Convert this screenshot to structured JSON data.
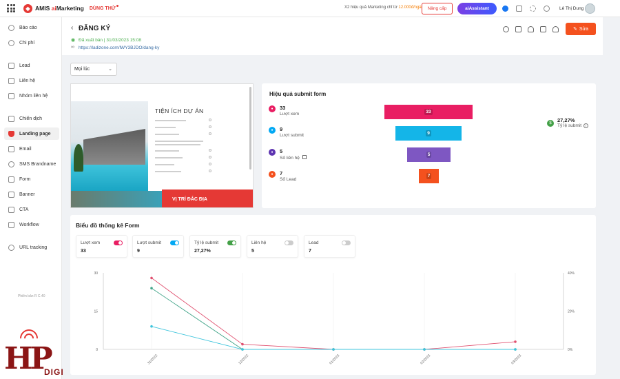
{
  "topbar": {
    "logo_text": "AMIS",
    "logo_ai": "ai",
    "logo_suffix": "Marketing",
    "trial": "DÙNG THỬ",
    "promo_text": "X2 hiệu quả Marketing chỉ từ",
    "promo_price": "12.000đ/ngày",
    "upgrade": "Nâng cấp",
    "ai_assistant": "aiAssistant",
    "user_name": "Lê Thị Dung"
  },
  "sidebar": {
    "items": [
      {
        "label": "Báo cáo"
      },
      {
        "label": "Chi phí"
      },
      {
        "label": "Lead"
      },
      {
        "label": "Liên hệ"
      },
      {
        "label": "Nhóm liên hệ"
      },
      {
        "label": "Chiến dịch"
      },
      {
        "label": "Landing page",
        "active": true
      },
      {
        "label": "Email"
      },
      {
        "label": "SMS Brandname"
      },
      {
        "label": "Form"
      },
      {
        "label": "Banner"
      },
      {
        "label": "CTA"
      },
      {
        "label": "Workflow"
      },
      {
        "label": "URL tracking"
      }
    ],
    "version": "Phiên bản R C.40"
  },
  "header": {
    "title": "ĐĂNG KÝ",
    "status": "Đã xuất bản | 31/03/2023 15:08",
    "url": "https://ladizone.com/lWY3BJDO/dang-ky",
    "edit": "Sửa"
  },
  "filter": {
    "value": "Mọi lúc"
  },
  "preview": {
    "heading": "TIỆN ÍCH DỰ ÁN",
    "banner": "VỊ TRÍ ĐẮC ĐỊA"
  },
  "funnel": {
    "title": "Hiệu quả submit form",
    "metrics": [
      {
        "value": "33",
        "label": "Lượt xem",
        "color": "#e91e63"
      },
      {
        "value": "9",
        "label": "Lượt submit",
        "color": "#03a9f4"
      },
      {
        "value": "5",
        "label": "Số liên hệ",
        "color": "#5e35b1"
      },
      {
        "value": "7",
        "label": "Số Lead",
        "color": "#f4511e"
      }
    ],
    "bars": [
      {
        "value": "33",
        "color": "#e91e63"
      },
      {
        "value": "9",
        "color": "#14b5e8"
      },
      {
        "value": "5",
        "color": "#7e57c2"
      },
      {
        "value": "7",
        "color": "#f4511e"
      }
    ],
    "rate_value": "27,27%",
    "rate_label": "Tỷ lệ submit"
  },
  "chart": {
    "title": "Biểu đồ thống kê Form",
    "stats": [
      {
        "label": "Lượt xem",
        "value": "33",
        "on": true,
        "color": "#e91e63"
      },
      {
        "label": "Lượt submit",
        "value": "9",
        "on": true,
        "color": "#03a9f4"
      },
      {
        "label": "Tỷ lệ submit",
        "value": "27,27%",
        "on": true,
        "color": "#43a047"
      },
      {
        "label": "Liên hệ",
        "value": "5",
        "on": false,
        "color": "#cccccc"
      },
      {
        "label": "Lead",
        "value": "7",
        "on": false,
        "color": "#cccccc"
      }
    ]
  },
  "chart_data": {
    "type": "line",
    "x": [
      "31/2022",
      "12/2022",
      "01/2023",
      "02/2023",
      "03/2023"
    ],
    "y_left_ticks": [
      0,
      15,
      30
    ],
    "y_right_ticks": [
      "0%",
      "20%",
      "40%"
    ],
    "ylim_left": [
      0,
      30
    ],
    "ylim_right": [
      0,
      40
    ],
    "series": [
      {
        "name": "Lượt xem",
        "axis": "left",
        "color": "#e0506f",
        "values": [
          28,
          2,
          0,
          0,
          3
        ]
      },
      {
        "name": "Tỷ lệ submit",
        "axis": "right",
        "color": "#43a58a",
        "values": [
          32,
          0,
          0,
          0,
          0
        ]
      },
      {
        "name": "Lượt submit",
        "axis": "left",
        "color": "#3cc4dc",
        "values": [
          9,
          0,
          0,
          0,
          0
        ]
      }
    ],
    "grid": "vertical"
  },
  "watermark": {
    "text": "HP",
    "sub": "DIGI"
  }
}
